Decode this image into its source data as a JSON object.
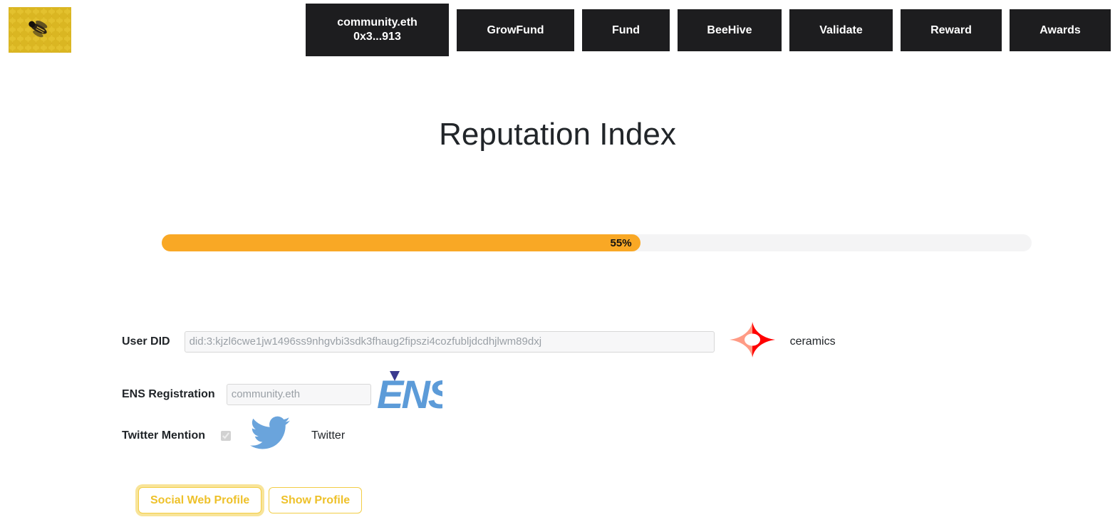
{
  "topbar": {
    "logo_alt": "honeycomb-bee-logo",
    "tabs": [
      {
        "label": "community.eth\n0x3...913",
        "name": "nav-account",
        "active": true
      },
      {
        "label": "GrowFund",
        "name": "nav-growfund",
        "active": false
      },
      {
        "label": "Fund",
        "name": "nav-fund",
        "active": false
      },
      {
        "label": "BeeHive",
        "name": "nav-beehive",
        "active": false
      },
      {
        "label": "Validate",
        "name": "nav-validate",
        "active": false
      },
      {
        "label": "Reward",
        "name": "nav-reward",
        "active": false
      },
      {
        "label": "Awards",
        "name": "nav-awards",
        "active": false
      }
    ]
  },
  "page": {
    "title": "Reputation Index"
  },
  "progress": {
    "percent": 55,
    "label": "55%",
    "fill_color": "#f9a825",
    "track_color": "#f4f4f5"
  },
  "form": {
    "did": {
      "label": "User DID",
      "value": "",
      "placeholder": "did:3:kjzl6cwe1jw1496ss9nhgvbi3sdk3fhaug2fipszi4cozfubljdcdhjlwm89dxj",
      "provider_name": "ceramics",
      "provider_icon": "ceramic-logo-icon"
    },
    "ens": {
      "label": "ENS Registration",
      "value": "",
      "placeholder": "community.eth",
      "provider_icon": "ens-logo-icon"
    },
    "twitter": {
      "label": "Twitter Mention",
      "checked": true,
      "disabled": true,
      "provider_name": "Twitter",
      "provider_icon": "twitter-bird-icon"
    }
  },
  "actions": {
    "social_web_profile": "Social Web Profile",
    "show_profile": "Show Profile",
    "accent_color": "#eec12a"
  }
}
